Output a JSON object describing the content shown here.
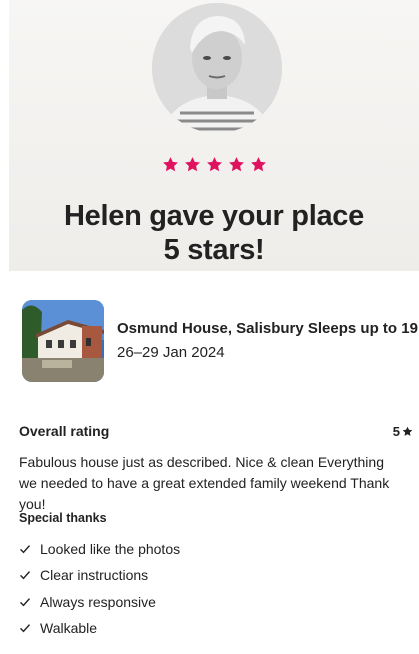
{
  "hero": {
    "title_line1": "Helen gave your place",
    "title_line2": "5 stars!",
    "stars": 5,
    "star_color": "#e0115f"
  },
  "listing": {
    "name": "Osmund House, Salisbury Sleeps up to 19",
    "dates": "26–29 Jan 2024"
  },
  "rating": {
    "label": "Overall rating",
    "value": "5"
  },
  "review": {
    "text": "Fabulous house just as described. Nice & clean Everything we needed to have a great extended family weekend Thank you!"
  },
  "special_thanks": {
    "title": "Special thanks",
    "items": [
      "Looked like the photos",
      "Clear instructions",
      "Always responsive",
      "Walkable"
    ]
  },
  "icons": {
    "star": "star-icon",
    "check": "check-icon"
  }
}
